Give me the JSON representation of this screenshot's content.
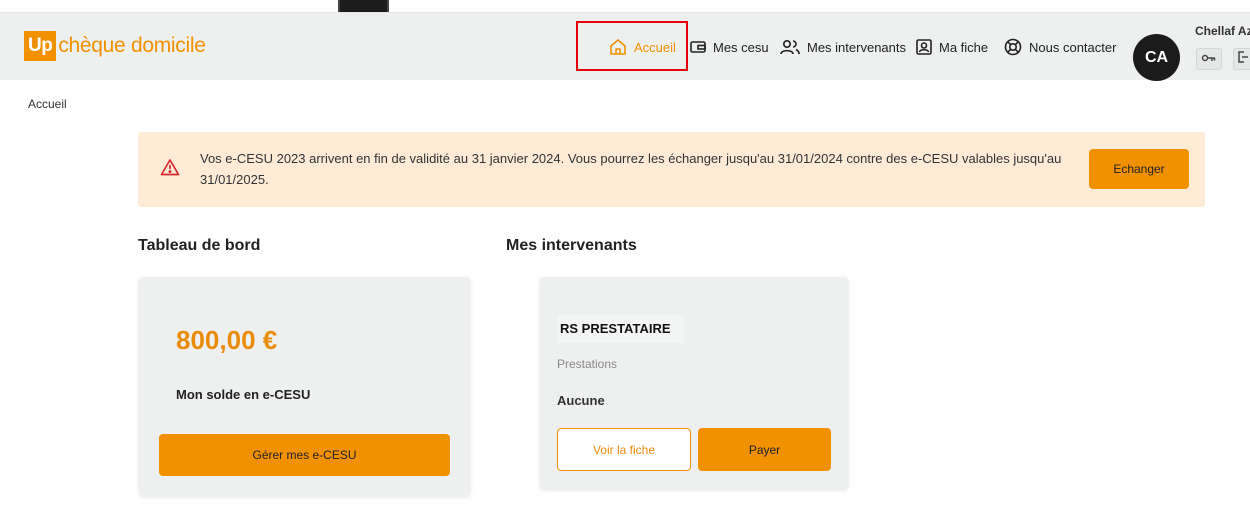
{
  "header": {
    "logo_badge": "Up",
    "logo_text": "chèque domicile",
    "nav": {
      "home": "Accueil",
      "cesu": "Mes cesu",
      "intervenants": "Mes intervenants",
      "fiche": "Ma fiche",
      "contact": "Nous contacter"
    },
    "avatar_initials": "CA",
    "user_name": "Chellaf Az"
  },
  "breadcrumb": "Accueil",
  "alert": {
    "icon": "warning-triangle-icon",
    "text": "Vos e-CESU 2023 arrivent en fin de validité au 31 janvier 2024. Vous pourrez les échanger jusqu'au 31/01/2024 contre des e-CESU valables jusqu'au 31/01/2025.",
    "button": "Echanger"
  },
  "dashboard": {
    "title": "Tableau de bord",
    "amount": "800,00 €",
    "label": "Mon solde en e-CESU",
    "button": "Gérer mes e-CESU"
  },
  "intervenants": {
    "title": "Mes intervenants",
    "name": "RS PRESTATAIRE",
    "prestations_label": "Prestations",
    "prestations_value": "Aucune",
    "view_button": "Voir la fiche",
    "pay_button": "Payer"
  },
  "colors": {
    "brand": "#f29100",
    "alert_bg": "#fdebd6",
    "header_bg": "#eef0f0",
    "highlight": "#e8000b"
  }
}
